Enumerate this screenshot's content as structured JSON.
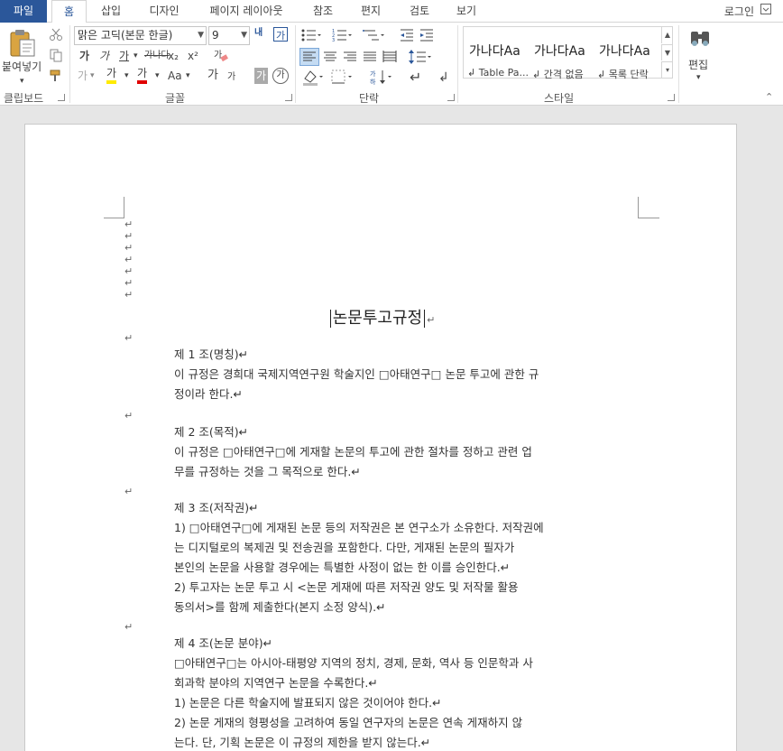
{
  "tabs": {
    "file": "파일",
    "home": "홈",
    "insert": "삽입",
    "design": "디자인",
    "layout": "페이지 레이아웃",
    "references": "참조",
    "mailings": "편지",
    "review": "검토",
    "view": "보기"
  },
  "account": {
    "login": "로그인"
  },
  "ribbon": {
    "clipboard": {
      "paste_label": "붙여넣기",
      "group_label": "클립보드"
    },
    "font": {
      "font_name": "맑은 고딕(본문 한글)",
      "font_size": "9",
      "bold": "가",
      "italic": "가",
      "underline": "가",
      "strike": "가나다",
      "subscript": "x₂",
      "superscript": "x²",
      "grow": "내",
      "change_case": "Aa",
      "group_label": "글꼴",
      "text_effect": "가",
      "highlight": "가",
      "font_color": "가",
      "shrink_a": "가",
      "shrink_b": "가",
      "char_shade": "가",
      "enclose": "가"
    },
    "paragraph": {
      "group_label": "단락"
    },
    "styles": {
      "group_label": "스타일",
      "items": [
        {
          "sample": "가나다Aa",
          "name": "↲ Table Pa..."
        },
        {
          "sample": "가나다Aa",
          "name": "↲ 간격 없음"
        },
        {
          "sample": "가나다Aa",
          "name": "↲ 목록 단락"
        }
      ]
    },
    "editing": {
      "label": "편집"
    }
  },
  "document": {
    "title": "논문투고규정",
    "paragraph_mark": "↵",
    "sections": [
      {
        "heading": "제 1 조(명칭)↵",
        "lines": [
          "이 규정은 경희대 국제지역연구원 학술지인 □아태연구□ 논문 투고에 관한 규",
          "정이라 한다.↵"
        ]
      },
      {
        "heading": "제 2 조(목적)↵",
        "lines": [
          "이 규정은 □아태연구□에 게재할 논문의 투고에 관한 절차를 정하고 관련 업",
          "무를 규정하는 것을 그 목적으로 한다.↵"
        ]
      },
      {
        "heading": "제 3 조(저작권)↵",
        "lines": [
          "1) □아태연구□에 게재된 논문 등의 저작권은 본 연구소가 소유한다. 저작권에",
          "    는 디지털로의 복제권 및 전송권을 포함한다. 다만, 게재된 논문의 필자가",
          "    본인의 논문을 사용할 경우에는 특별한 사정이 없는 한 이를 승인한다.↵",
          "2) 투고자는 논문 투고 시 <논문 게재에 따른 저작권 양도 및 저작물 활용",
          "    동의서>를 함께 제출한다(본지 소정 양식).↵"
        ]
      },
      {
        "heading": "제 4 조(논문 분야)↵",
        "lines": [
          "□아태연구□는 아시아-태평양 지역의 정치, 경제, 문화, 역사 등 인문학과 사",
          "회과학 분야의 지역연구 논문을 수록한다.↵",
          "1) 논문은 다른 학술지에 발표되지 않은 것이어야 한다.↵",
          "2) 논문 게재의 형평성을 고려하여 동일 연구자의 논문은 연속 게재하지 않",
          "    는다. 단, 기획 논문은 이 규정의 제한을 받지 않는다.↵"
        ]
      }
    ]
  }
}
